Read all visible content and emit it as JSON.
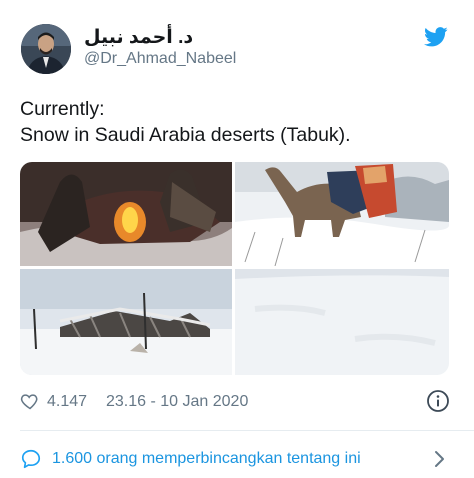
{
  "author": {
    "display_name": "د. أحمد نبيل",
    "handle": "@Dr_Ahmad_Nabeel"
  },
  "tweet": {
    "lines": [
      "Currently:",
      "Snow in Saudi Arabia deserts (Tabuk)."
    ]
  },
  "media": {
    "photos": [
      "campfire-photo",
      "camel-photo",
      "tent-photo",
      "snow-ground-photo"
    ]
  },
  "footer": {
    "likes": "4.147",
    "timestamp": "23.16 - 10 Jan 2020"
  },
  "conversation": {
    "label": "1.600 orang memperbincangkan tentang ini"
  },
  "colors": {
    "brand": "#1da1f2",
    "muted": "#657786",
    "text": "#14171a",
    "divider": "#e6ecf0"
  }
}
